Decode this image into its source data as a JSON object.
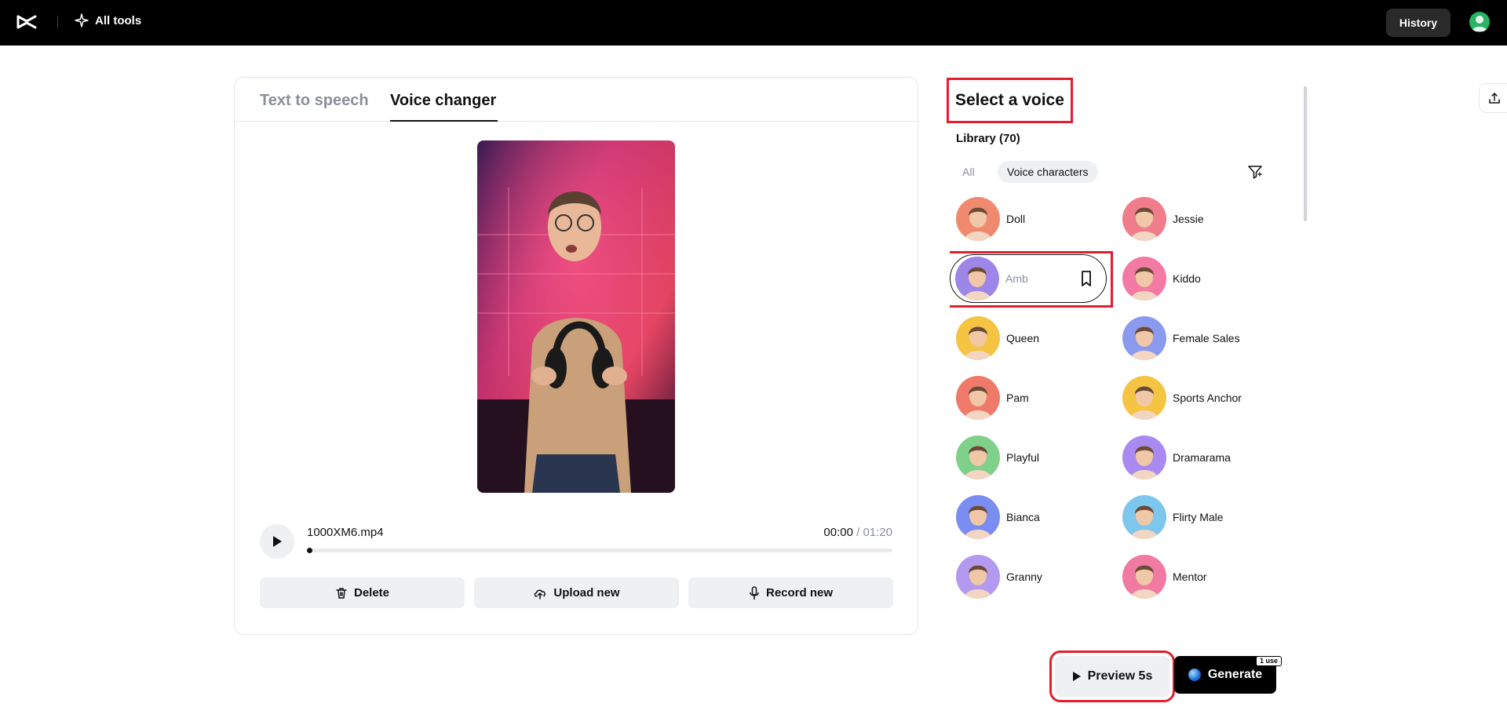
{
  "topbar": {
    "all_tools_label": "All tools",
    "history_label": "History"
  },
  "tabs": [
    {
      "label": "Text to speech",
      "active": false
    },
    {
      "label": "Voice changer",
      "active": true
    }
  ],
  "player": {
    "file_name": "1000XM6.mp4",
    "current_time": "00:00",
    "separator": " / ",
    "total_time": "01:20",
    "progress_fraction": 0.0
  },
  "actions": {
    "delete_label": "Delete",
    "upload_label": "Upload new",
    "record_label": "Record new"
  },
  "voice_panel": {
    "title": "Select a voice",
    "library_label": "Library (70)",
    "filters": [
      {
        "label": "All",
        "active": false
      },
      {
        "label": "Voice characters",
        "active": true
      }
    ],
    "voices": [
      {
        "name": "Doll",
        "color": "#f08a6e"
      },
      {
        "name": "Jessie",
        "color": "#f17c8c"
      },
      {
        "name": "Amb",
        "color": "#9d86e8",
        "selected": true
      },
      {
        "name": "Kiddo",
        "color": "#f47aa6"
      },
      {
        "name": "Queen",
        "color": "#f5c443"
      },
      {
        "name": "Female Sales",
        "color": "#8a9bef"
      },
      {
        "name": "Pam",
        "color": "#f07a6a"
      },
      {
        "name": "Sports Anchor",
        "color": "#f5c443"
      },
      {
        "name": "Playful",
        "color": "#7fd08a"
      },
      {
        "name": "Dramarama",
        "color": "#a98af0"
      },
      {
        "name": "Bianca",
        "color": "#7a8df0"
      },
      {
        "name": "Flirty Male",
        "color": "#7dc6ee"
      },
      {
        "name": "Granny",
        "color": "#b39af0"
      },
      {
        "name": "Mentor",
        "color": "#f07aa2"
      }
    ]
  },
  "bottom": {
    "preview_label": "Preview 5s",
    "generate_label": "Generate",
    "use_badge": "1 use"
  }
}
